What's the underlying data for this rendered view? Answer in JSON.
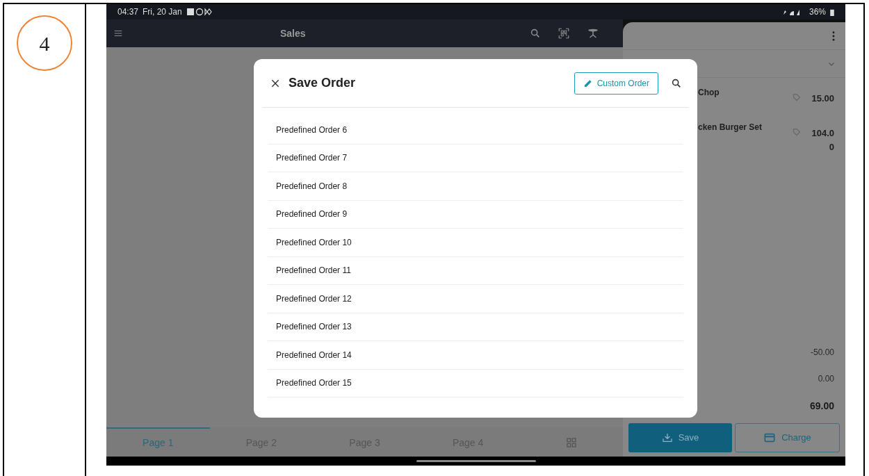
{
  "step": {
    "number": "4"
  },
  "status_bar": {
    "time": "04:37",
    "date": "Fri, 20 Jan",
    "battery": "36%"
  },
  "app_bar": {
    "title": "Sales"
  },
  "order_panel": {
    "items": [
      {
        "name": "Chop",
        "price": "15.00"
      },
      {
        "name": "cken Burger Set",
        "price": "104.00"
      }
    ],
    "summary": [
      "-50.00",
      "0.00"
    ],
    "total": "69.00",
    "buttons": [
      {
        "label": "Save",
        "kind": "primary"
      },
      {
        "label": "Charge",
        "kind": "outline"
      }
    ]
  },
  "page_tabs": [
    {
      "label": "Page 1",
      "selected": true
    },
    {
      "label": "Page 2",
      "selected": false
    },
    {
      "label": "Page 3",
      "selected": false
    },
    {
      "label": "Page 4",
      "selected": false
    }
  ],
  "dialog": {
    "title": "Save Order",
    "custom_button": "Custom Order",
    "items": [
      "Predefined Order 6",
      "Predefined Order 7",
      "Predefined Order 8",
      "Predefined Order 9",
      "Predefined Order 10",
      "Predefined Order 11",
      "Predefined Order 12",
      "Predefined Order 13",
      "Predefined Order 14",
      "Predefined Order 15"
    ]
  }
}
